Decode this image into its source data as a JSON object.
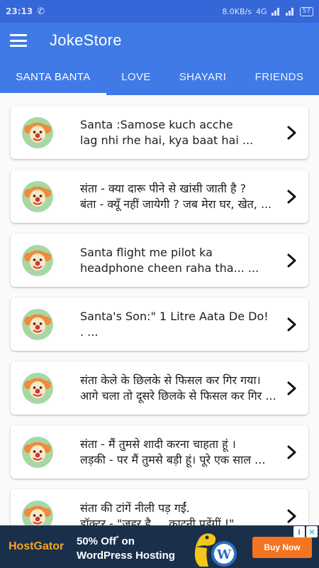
{
  "status_bar": {
    "time": "23:13",
    "network_speed": "8.0KB/s",
    "network_type": "4G",
    "battery": "57"
  },
  "app": {
    "title": "JokeStore"
  },
  "tabs": [
    {
      "label": "SANTA BANTA",
      "active": true
    },
    {
      "label": "LOVE",
      "active": false
    },
    {
      "label": "SHAYARI",
      "active": false
    },
    {
      "label": "FRIENDS",
      "active": false
    }
  ],
  "jokes": [
    {
      "line1": "Santa :Samose kuch acche",
      "line2": "lag nhi rhe hai, kya baat hai ..."
    },
    {
      "line1": "संता - क्या दारू पीने से खांसी जाती है ?",
      "line2": "बंता - क्यूँ नहीं जायेगी ? जब मेरा घर, खेत, ..."
    },
    {
      "line1": "Santa flight me pilot ka",
      "line2": "headphone cheen raha tha... ..."
    },
    {
      "line1": "Santa's Son:\" 1 Litre Aata De Do!",
      "line2": ". ..."
    },
    {
      "line1": "संता केले के छिलके से फिसल कर गिर गया।",
      "line2": "आगे चला तो दूसरे छिलके से फिसल कर गिर ..."
    },
    {
      "line1": "संता - मैं तुमसे शादी करना चाहता हूं ।",
      "line2": "लड़की - पर मैं तुमसे बड़ी हूं। पूरे एक साल ..."
    },
    {
      "line1": "संता की टांगें नीली पड़ गईं.",
      "line2": "डॉक्टर - \"जहर है ... काटनी पड़ेंगीं !\""
    }
  ],
  "ad": {
    "brand": "HostGator",
    "offer_line1": "50% Off",
    "offer_sup": "*",
    "offer_line1_tail": " on",
    "offer_line2": "WordPress Hosting",
    "cta": "Buy Now"
  },
  "colors": {
    "primary": "#3f7ae6",
    "status_bar": "#3567d8",
    "avatar_bg": "#a7d8a4",
    "ad_bg": "#1a2f4a",
    "ad_cta": "#f37421"
  }
}
